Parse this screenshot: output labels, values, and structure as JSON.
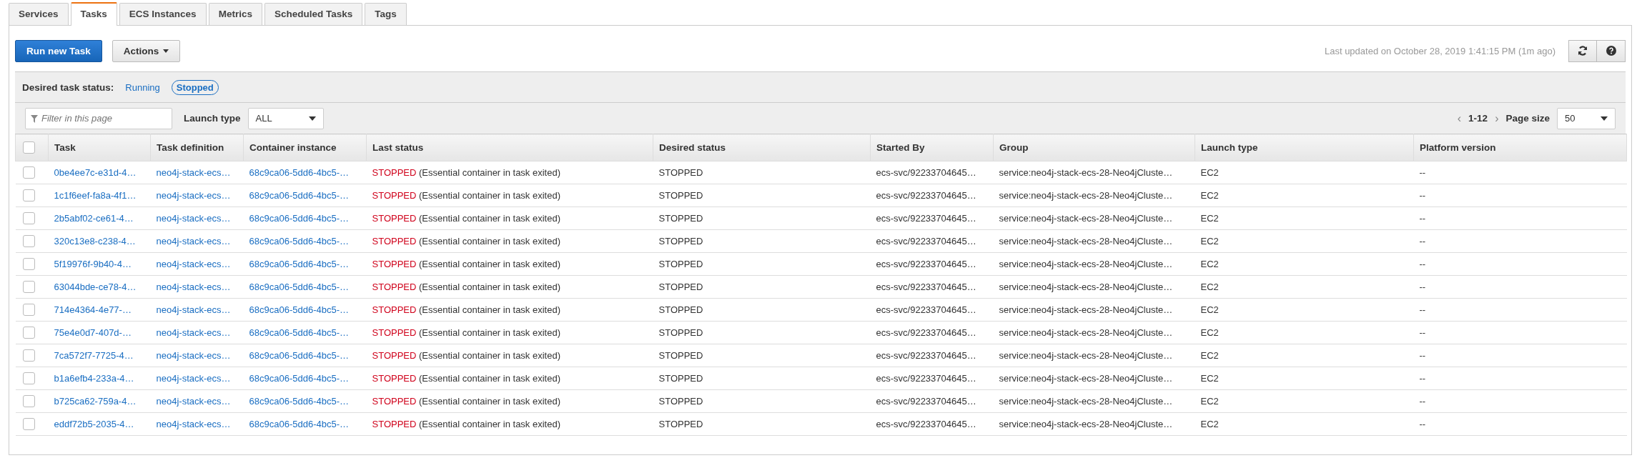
{
  "tabs": [
    {
      "label": "Services",
      "selected": false
    },
    {
      "label": "Tasks",
      "selected": true
    },
    {
      "label": "ECS Instances",
      "selected": false
    },
    {
      "label": "Metrics",
      "selected": false
    },
    {
      "label": "Scheduled Tasks",
      "selected": false
    },
    {
      "label": "Tags",
      "selected": false
    }
  ],
  "toolbar": {
    "primary_button": "Run new Task",
    "actions_button": "Actions",
    "last_updated": "Last updated on October 28, 2019 1:41:15 PM (1m ago)"
  },
  "desired_task_status": {
    "label": "Desired task status:",
    "options": [
      {
        "label": "Running",
        "selected": false
      },
      {
        "label": "Stopped",
        "selected": true
      }
    ]
  },
  "filter": {
    "placeholder": "Filter in this page",
    "launch_type_label": "Launch type",
    "launch_type_value": "ALL"
  },
  "pagination": {
    "prev": "‹",
    "range": "1-12",
    "next": "›",
    "page_size_label": "Page size",
    "page_size_value": "50"
  },
  "table": {
    "select_all_checked": false,
    "columns": [
      "Task",
      "Task definition",
      "Container instance",
      "Last status",
      "Desired status",
      "Started By",
      "Group",
      "Launch type",
      "Platform version"
    ],
    "rows": [
      {
        "checked": false,
        "cells": [
          "0be4ee7c-e31d-4…",
          "neo4j-stack-ecs…",
          "68c9ca06-5dd6-4bc5-…",
          {
            "status": "STOPPED",
            "reason": "(Essential container in task exited)"
          },
          "STOPPED",
          "ecs-svc/92233704645…",
          "service:neo4j-stack-ecs-28-Neo4jCluste…",
          "EC2",
          "--"
        ]
      },
      {
        "checked": false,
        "cells": [
          "1c1f6eef-fa8a-4f1…",
          "neo4j-stack-ecs…",
          "68c9ca06-5dd6-4bc5-…",
          {
            "status": "STOPPED",
            "reason": "(Essential container in task exited)"
          },
          "STOPPED",
          "ecs-svc/92233704645…",
          "service:neo4j-stack-ecs-28-Neo4jCluste…",
          "EC2",
          "--"
        ]
      },
      {
        "checked": false,
        "cells": [
          "2b5abf02-ce61-4…",
          "neo4j-stack-ecs…",
          "68c9ca06-5dd6-4bc5-…",
          {
            "status": "STOPPED",
            "reason": "(Essential container in task exited)"
          },
          "STOPPED",
          "ecs-svc/92233704645…",
          "service:neo4j-stack-ecs-28-Neo4jCluste…",
          "EC2",
          "--"
        ]
      },
      {
        "checked": false,
        "cells": [
          "320c13e8-c238-4…",
          "neo4j-stack-ecs…",
          "68c9ca06-5dd6-4bc5-…",
          {
            "status": "STOPPED",
            "reason": "(Essential container in task exited)"
          },
          "STOPPED",
          "ecs-svc/92233704645…",
          "service:neo4j-stack-ecs-28-Neo4jCluste…",
          "EC2",
          "--"
        ]
      },
      {
        "checked": false,
        "cells": [
          "5f19976f-9b40-4…",
          "neo4j-stack-ecs…",
          "68c9ca06-5dd6-4bc5-…",
          {
            "status": "STOPPED",
            "reason": "(Essential container in task exited)"
          },
          "STOPPED",
          "ecs-svc/92233704645…",
          "service:neo4j-stack-ecs-28-Neo4jCluste…",
          "EC2",
          "--"
        ]
      },
      {
        "checked": false,
        "cells": [
          "63044bde-ce78-4…",
          "neo4j-stack-ecs…",
          "68c9ca06-5dd6-4bc5-…",
          {
            "status": "STOPPED",
            "reason": "(Essential container in task exited)"
          },
          "STOPPED",
          "ecs-svc/92233704645…",
          "service:neo4j-stack-ecs-28-Neo4jCluste…",
          "EC2",
          "--"
        ]
      },
      {
        "checked": false,
        "cells": [
          "714e4364-4e77-…",
          "neo4j-stack-ecs…",
          "68c9ca06-5dd6-4bc5-…",
          {
            "status": "STOPPED",
            "reason": "(Essential container in task exited)"
          },
          "STOPPED",
          "ecs-svc/92233704645…",
          "service:neo4j-stack-ecs-28-Neo4jCluste…",
          "EC2",
          "--"
        ]
      },
      {
        "checked": false,
        "cells": [
          "75e4e0d7-407d-…",
          "neo4j-stack-ecs…",
          "68c9ca06-5dd6-4bc5-…",
          {
            "status": "STOPPED",
            "reason": "(Essential container in task exited)"
          },
          "STOPPED",
          "ecs-svc/92233704645…",
          "service:neo4j-stack-ecs-28-Neo4jCluste…",
          "EC2",
          "--"
        ]
      },
      {
        "checked": false,
        "cells": [
          "7ca572f7-7725-4…",
          "neo4j-stack-ecs…",
          "68c9ca06-5dd6-4bc5-…",
          {
            "status": "STOPPED",
            "reason": "(Essential container in task exited)"
          },
          "STOPPED",
          "ecs-svc/92233704645…",
          "service:neo4j-stack-ecs-28-Neo4jCluste…",
          "EC2",
          "--"
        ]
      },
      {
        "checked": false,
        "cells": [
          "b1a6efb4-233a-4…",
          "neo4j-stack-ecs…",
          "68c9ca06-5dd6-4bc5-…",
          {
            "status": "STOPPED",
            "reason": "(Essential container in task exited)"
          },
          "STOPPED",
          "ecs-svc/92233704645…",
          "service:neo4j-stack-ecs-28-Neo4jCluste…",
          "EC2",
          "--"
        ]
      },
      {
        "checked": false,
        "cells": [
          "b725ca62-759a-4…",
          "neo4j-stack-ecs…",
          "68c9ca06-5dd6-4bc5-…",
          {
            "status": "STOPPED",
            "reason": "(Essential container in task exited)"
          },
          "STOPPED",
          "ecs-svc/92233704645…",
          "service:neo4j-stack-ecs-28-Neo4jCluste…",
          "EC2",
          "--"
        ]
      },
      {
        "checked": false,
        "cells": [
          "eddf72b5-2035-4…",
          "neo4j-stack-ecs…",
          "68c9ca06-5dd6-4bc5-…",
          {
            "status": "STOPPED",
            "reason": "(Essential container in task exited)"
          },
          "STOPPED",
          "ecs-svc/92233704645…",
          "service:neo4j-stack-ecs-28-Neo4jCluste…",
          "EC2",
          "--"
        ]
      }
    ]
  }
}
